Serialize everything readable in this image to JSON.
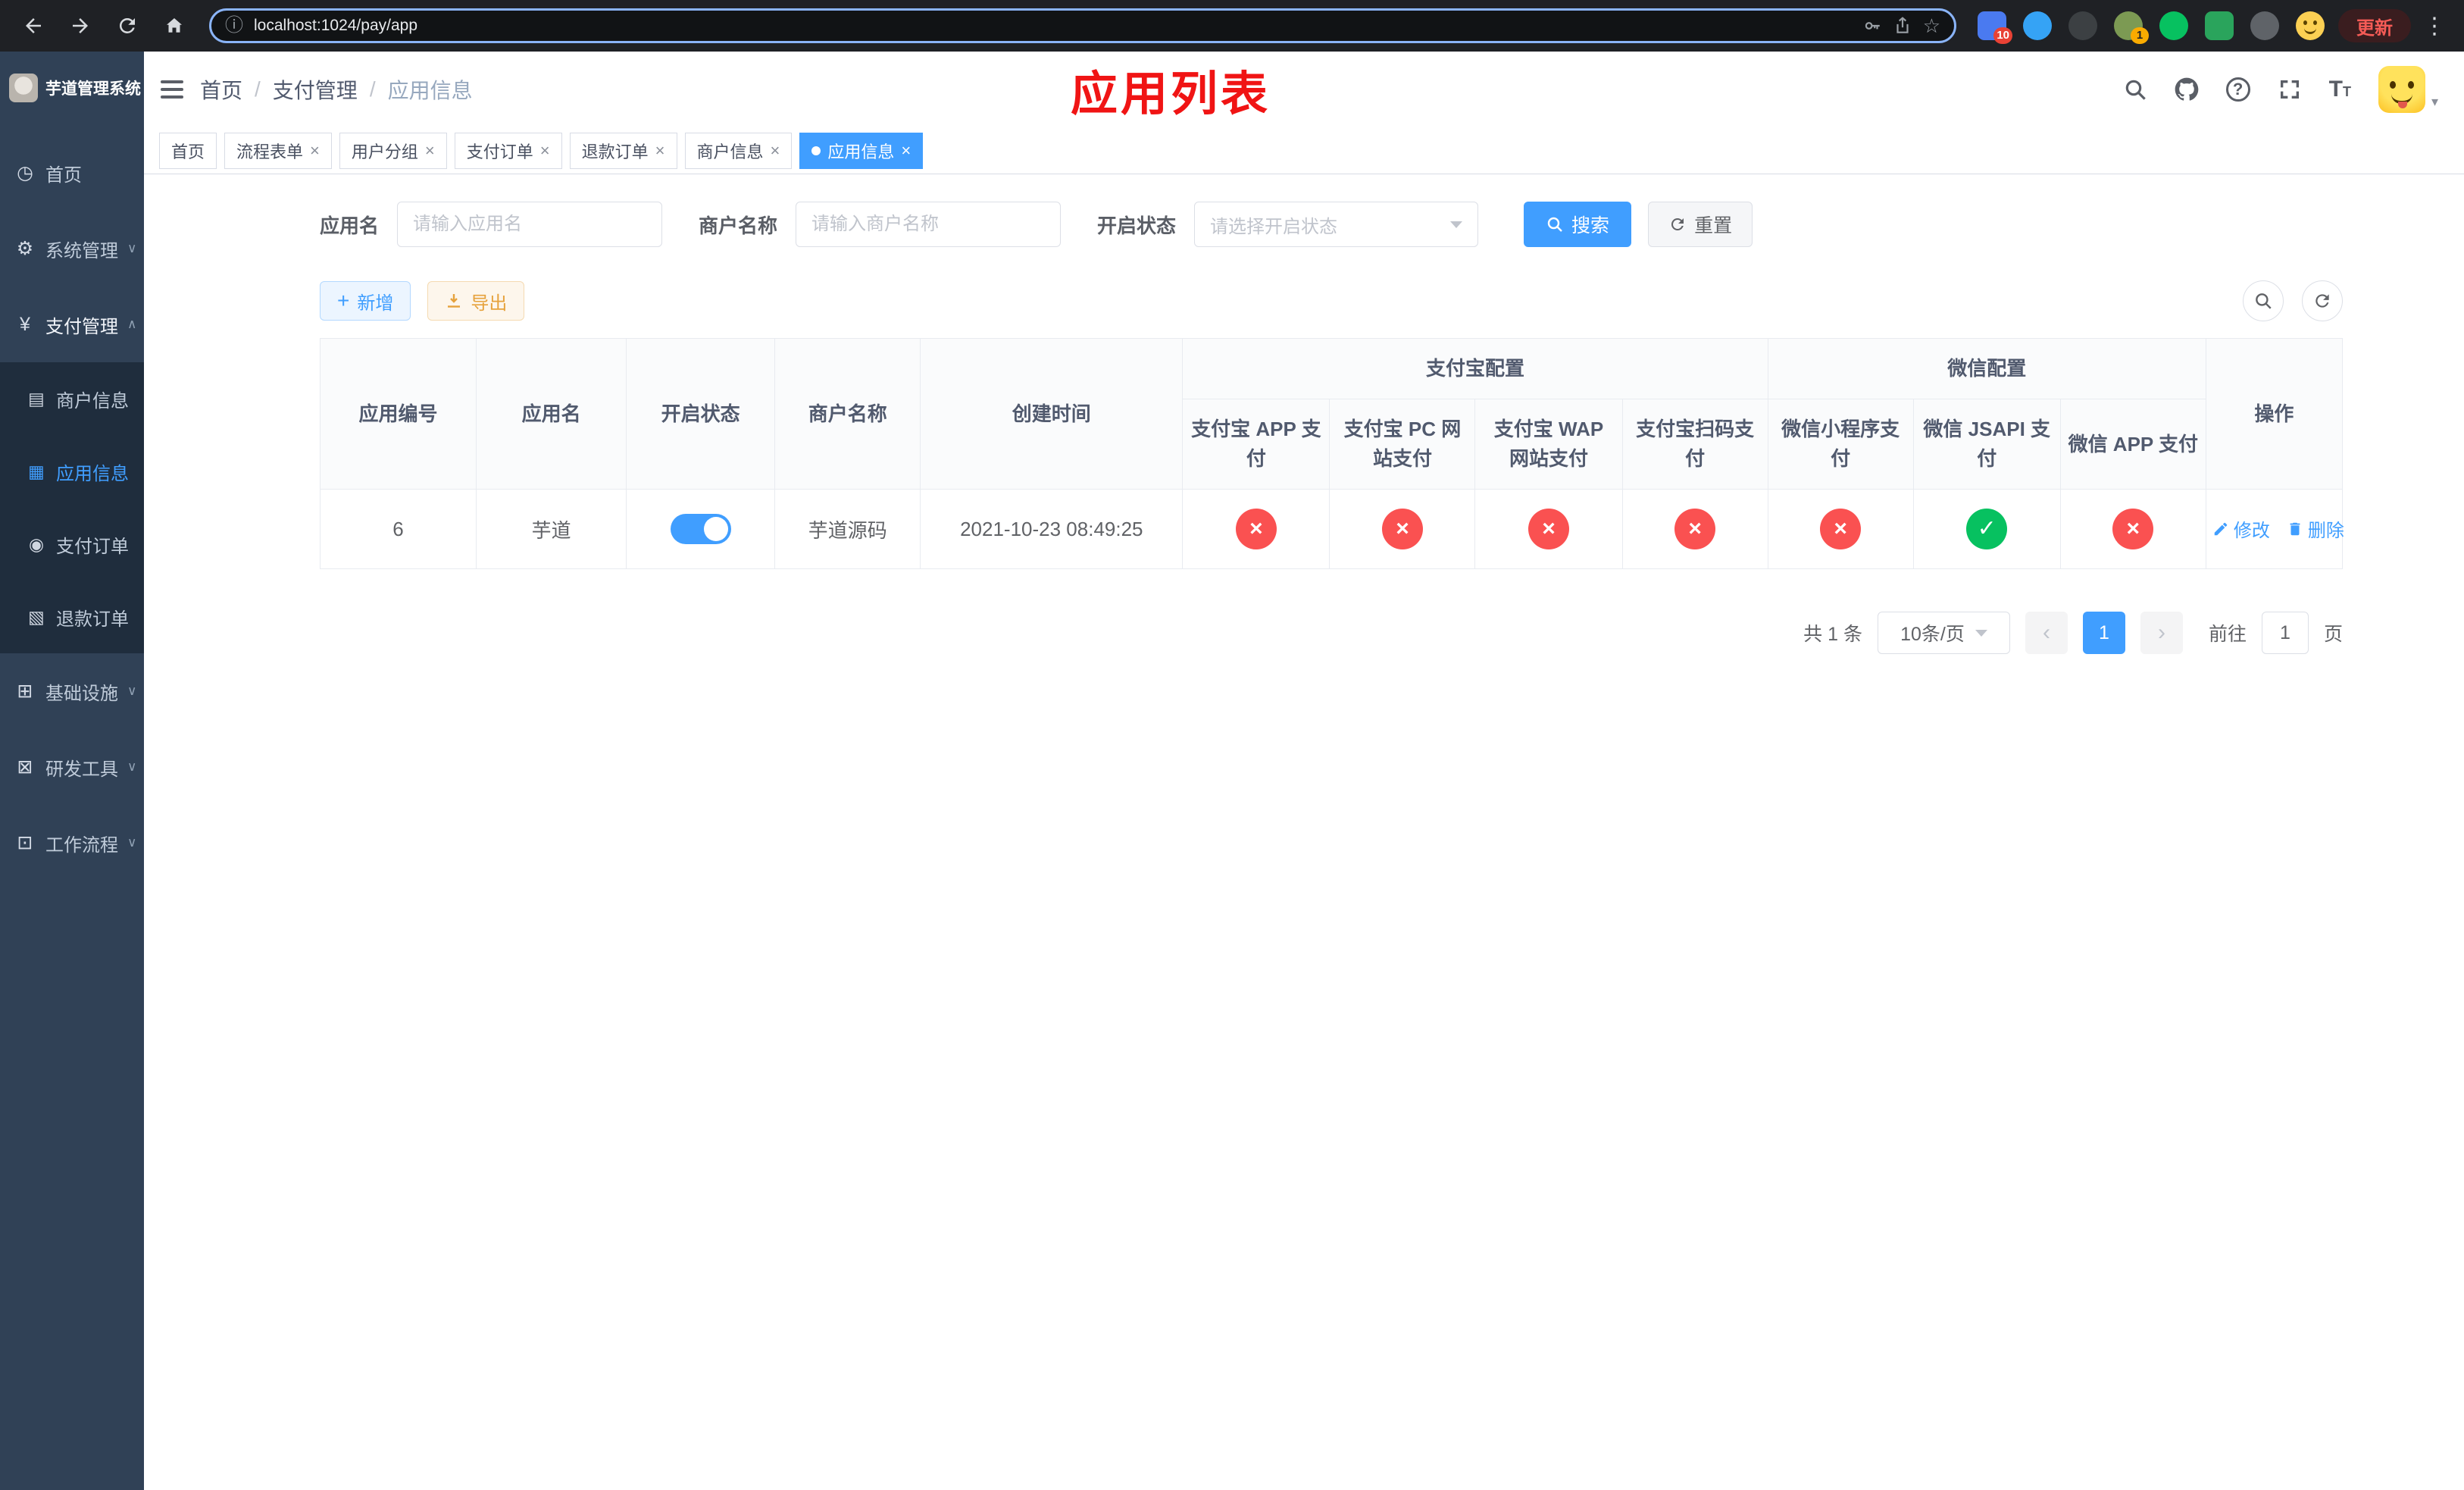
{
  "colors": {
    "primary": "#409eff",
    "success": "#07c160",
    "danger": "#fa5151",
    "warning": "#e6a23c",
    "page_title_red": "#f01414",
    "sidebar_bg": "#304156",
    "submenu_bg": "#1f2d3d"
  },
  "browser": {
    "url": "localhost:1024/pay/app",
    "update_label": "更新",
    "extension_badge_count": "10",
    "profile_badge_count": "1"
  },
  "sidebar": {
    "title": "芋道管理系统",
    "home": "首页",
    "system": "系统管理",
    "payment": "支付管理",
    "merchant_info": "商户信息",
    "app_info": "应用信息",
    "pay_order": "支付订单",
    "refund_order": "退款订单",
    "infrastructure": "基础设施",
    "dev_tools": "研发工具",
    "workflow": "工作流程"
  },
  "navbar": {
    "breadcrumb": {
      "home": "首页",
      "section": "支付管理",
      "current": "应用信息"
    },
    "page_title": "应用列表"
  },
  "tags": [
    {
      "label": "首页",
      "closable": false,
      "active": false
    },
    {
      "label": "流程表单",
      "closable": true,
      "active": false
    },
    {
      "label": "用户分组",
      "closable": true,
      "active": false
    },
    {
      "label": "支付订单",
      "closable": true,
      "active": false
    },
    {
      "label": "退款订单",
      "closable": true,
      "active": false
    },
    {
      "label": "商户信息",
      "closable": true,
      "active": false
    },
    {
      "label": "应用信息",
      "closable": true,
      "active": true
    }
  ],
  "filters": {
    "app_name": {
      "label": "应用名",
      "placeholder": "请输入应用名",
      "value": ""
    },
    "merchant_name": {
      "label": "商户名称",
      "placeholder": "请输入商户名称",
      "value": ""
    },
    "status": {
      "label": "开启状态",
      "placeholder": "请选择开启状态",
      "value": ""
    },
    "search_label": "搜索",
    "reset_label": "重置"
  },
  "toolbar": {
    "add_label": "新增",
    "export_label": "导出"
  },
  "table": {
    "headers": {
      "app_id": "应用编号",
      "app_name": "应用名",
      "status": "开启状态",
      "merchant_name": "商户名称",
      "created_at": "创建时间",
      "alipay_group": "支付宝配置",
      "wechat_group": "微信配置",
      "actions": "操作",
      "sub": [
        "支付宝 APP 支付",
        "支付宝 PC 网站支付",
        "支付宝 WAP 网站支付",
        "支付宝扫码支付",
        "微信小程序支付",
        "微信 JSAPI 支付",
        "微信 APP 支付"
      ]
    },
    "rows": [
      {
        "app_id": "6",
        "app_name": "芋道",
        "enabled": true,
        "merchant_name": "芋道源码",
        "created_at": "2021-10-23 08:49:25",
        "configs": [
          false,
          false,
          false,
          false,
          false,
          true,
          false
        ],
        "edit_label": "修改",
        "delete_label": "删除"
      }
    ]
  },
  "pagination": {
    "total_text": "共 1 条",
    "page_size_text": "10条/页",
    "current_page": "1",
    "goto_prefix": "前往",
    "goto_value": "1",
    "goto_suffix": "页"
  }
}
